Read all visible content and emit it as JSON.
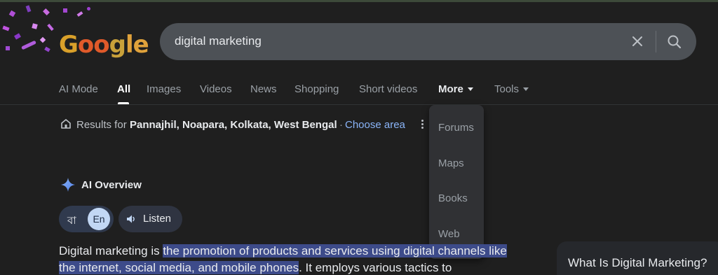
{
  "logo": {
    "part_g": "G",
    "part_oo": "oo",
    "part_g2": "g",
    "part_le": "le"
  },
  "search": {
    "query": "digital marketing"
  },
  "tabs": [
    {
      "label": "AI Mode"
    },
    {
      "label": "All"
    },
    {
      "label": "Images"
    },
    {
      "label": "Videos"
    },
    {
      "label": "News"
    },
    {
      "label": "Shopping"
    },
    {
      "label": "Short videos"
    },
    {
      "label": "More"
    },
    {
      "label": "Tools"
    }
  ],
  "more_menu": [
    {
      "label": "Forums"
    },
    {
      "label": "Maps"
    },
    {
      "label": "Books"
    },
    {
      "label": "Web"
    }
  ],
  "location": {
    "prefix": "Results for",
    "place": "Pannajhil, Noapara, Kolkata, West Bengal",
    "separator": "·",
    "choose_area": "Choose area"
  },
  "ai_overview": {
    "title": "AI Overview",
    "lang_bn": "বা",
    "lang_en": "En",
    "listen": "Listen",
    "text_before": "Digital marketing is ",
    "text_highlight": "the promotion of products and services using digital channels like the internet, social media, and mobile phones",
    "text_after": ". It employs various tactics to"
  },
  "side_card": {
    "title": "What Is Digital Marketing?"
  },
  "colors": {
    "background": "#1f1f1f",
    "search_box": "#4d5156",
    "link": "#8ab4f8",
    "highlight": "#3d4b8a"
  }
}
